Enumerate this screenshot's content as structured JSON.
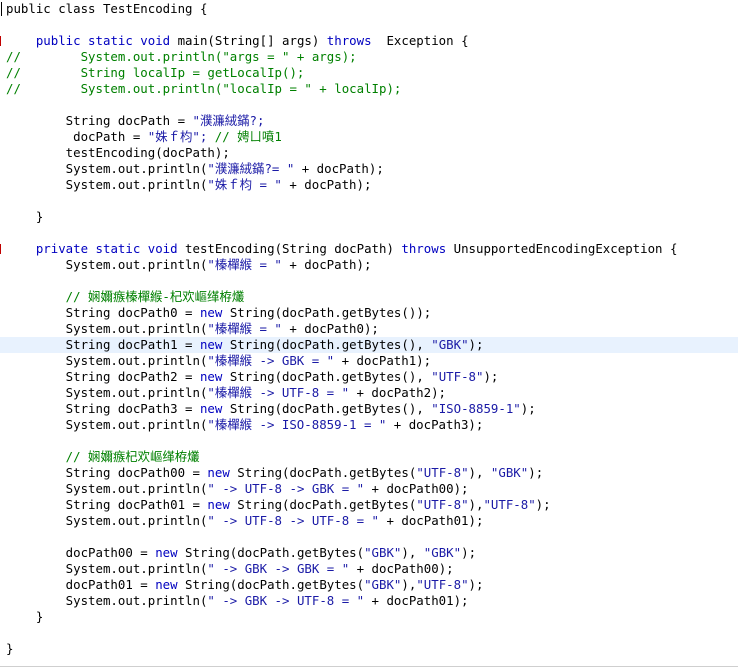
{
  "editor": {
    "lines": [
      [
        {
          "t": "public class TestEncoding {",
          "c": "plain"
        }
      ],
      [],
      [
        {
          "t": "    ",
          "c": "plain"
        },
        {
          "t": "public static void",
          "c": "kw"
        },
        {
          "t": " main(String[] args) ",
          "c": "plain"
        },
        {
          "t": "throws",
          "c": "kw"
        },
        {
          "t": "  Exception {",
          "c": "plain"
        }
      ],
      [
        {
          "t": "//        System.out.println(\"args = \" + args);",
          "c": "cm"
        }
      ],
      [
        {
          "t": "//        String localIp = getLocalIp();",
          "c": "cm"
        }
      ],
      [
        {
          "t": "//        System.out.println(\"localIp = \" + localIp);",
          "c": "cm"
        }
      ],
      [],
      [
        {
          "t": "        String docPath = ",
          "c": "plain"
        },
        {
          "t": "\"濮濂絨鏋?;",
          "c": "str"
        }
      ],
      [
        {
          "t": "         docPath = ",
          "c": "plain"
        },
        {
          "t": "\"姝ｆ枃\";",
          "c": "str"
        },
        {
          "t": " // 娉ㄩ噴1",
          "c": "cm"
        }
      ],
      [
        {
          "t": "        testEncoding(docPath);",
          "c": "plain"
        }
      ],
      [
        {
          "t": "        System.out.println(",
          "c": "plain"
        },
        {
          "t": "\"濮濂絨鏋?= \"",
          "c": "str"
        },
        {
          "t": " + docPath);",
          "c": "plain"
        }
      ],
      [
        {
          "t": "        System.out.println(",
          "c": "plain"
        },
        {
          "t": "\"姝ｆ枃 = \"",
          "c": "str"
        },
        {
          "t": " + docPath);",
          "c": "plain"
        }
      ],
      [],
      [
        {
          "t": "    }",
          "c": "plain"
        }
      ],
      [],
      [
        {
          "t": "    ",
          "c": "plain"
        },
        {
          "t": "private static void",
          "c": "kw"
        },
        {
          "t": " testEncoding(String docPath) ",
          "c": "plain"
        },
        {
          "t": "throws",
          "c": "kw"
        },
        {
          "t": " UnsupportedEncodingException {",
          "c": "plain"
        }
      ],
      [
        {
          "t": "        System.out.println(",
          "c": "plain"
        },
        {
          "t": "\"榛樿緱 = \"",
          "c": "str"
        },
        {
          "t": " + docPath);",
          "c": "plain"
        }
      ],
      [],
      [
        {
          "t": "        // 娴嬭瘯榛樿緱-杞欢嶇缂栫爜",
          "c": "cm"
        }
      ],
      [
        {
          "t": "        String docPath0 = ",
          "c": "plain"
        },
        {
          "t": "new",
          "c": "kw"
        },
        {
          "t": " String(docPath.getBytes());",
          "c": "plain"
        }
      ],
      [
        {
          "t": "        System.out.println(",
          "c": "plain"
        },
        {
          "t": "\"榛樿緱 = \"",
          "c": "str"
        },
        {
          "t": " + docPath0);",
          "c": "plain"
        }
      ],
      [
        {
          "t": "        String docPath1 = ",
          "c": "plain"
        },
        {
          "t": "new",
          "c": "kw"
        },
        {
          "t": " String(docPath.getBytes(), ",
          "c": "plain"
        },
        {
          "t": "\"GBK\"",
          "c": "str"
        },
        {
          "t": ");",
          "c": "plain"
        }
      ],
      [
        {
          "t": "        System.out.println(",
          "c": "plain"
        },
        {
          "t": "\"榛樿緱 -> GBK = \"",
          "c": "str"
        },
        {
          "t": " + docPath1);",
          "c": "plain"
        }
      ],
      [
        {
          "t": "        String docPath2 = ",
          "c": "plain"
        },
        {
          "t": "new",
          "c": "kw"
        },
        {
          "t": " String(docPath.getBytes(), ",
          "c": "plain"
        },
        {
          "t": "\"UTF-8\"",
          "c": "str"
        },
        {
          "t": ");",
          "c": "plain"
        }
      ],
      [
        {
          "t": "        System.out.println(",
          "c": "plain"
        },
        {
          "t": "\"榛樿緱 -> UTF-8 = \"",
          "c": "str"
        },
        {
          "t": " + docPath2);",
          "c": "plain"
        }
      ],
      [
        {
          "t": "        String docPath3 = ",
          "c": "plain"
        },
        {
          "t": "new",
          "c": "kw"
        },
        {
          "t": " String(docPath.getBytes(), ",
          "c": "plain"
        },
        {
          "t": "\"ISO-8859-1\"",
          "c": "str"
        },
        {
          "t": ");",
          "c": "plain"
        }
      ],
      [
        {
          "t": "        System.out.println(",
          "c": "plain"
        },
        {
          "t": "\"榛樿緱 -> ISO-8859-1 = \"",
          "c": "str"
        },
        {
          "t": " + docPath3);",
          "c": "plain"
        }
      ],
      [],
      [
        {
          "t": "        // 娴嬭瘯杞欢嶇缂栫爜",
          "c": "cm"
        }
      ],
      [
        {
          "t": "        String docPath00 = ",
          "c": "plain"
        },
        {
          "t": "new",
          "c": "kw"
        },
        {
          "t": " String(docPath.getBytes(",
          "c": "plain"
        },
        {
          "t": "\"UTF-8\"",
          "c": "str"
        },
        {
          "t": "), ",
          "c": "plain"
        },
        {
          "t": "\"GBK\"",
          "c": "str"
        },
        {
          "t": ");",
          "c": "plain"
        }
      ],
      [
        {
          "t": "        System.out.println(",
          "c": "plain"
        },
        {
          "t": "\" -> UTF-8 -> GBK = \"",
          "c": "str"
        },
        {
          "t": " + docPath00);",
          "c": "plain"
        }
      ],
      [
        {
          "t": "        String docPath01 = ",
          "c": "plain"
        },
        {
          "t": "new",
          "c": "kw"
        },
        {
          "t": " String(docPath.getBytes(",
          "c": "plain"
        },
        {
          "t": "\"UTF-8\"",
          "c": "str"
        },
        {
          "t": "),",
          "c": "plain"
        },
        {
          "t": "\"UTF-8\"",
          "c": "str"
        },
        {
          "t": ");",
          "c": "plain"
        }
      ],
      [
        {
          "t": "        System.out.println(",
          "c": "plain"
        },
        {
          "t": "\" -> UTF-8 -> UTF-8 = \"",
          "c": "str"
        },
        {
          "t": " + docPath01);",
          "c": "plain"
        }
      ],
      [],
      [
        {
          "t": "        docPath00 = ",
          "c": "plain"
        },
        {
          "t": "new",
          "c": "kw"
        },
        {
          "t": " String(docPath.getBytes(",
          "c": "plain"
        },
        {
          "t": "\"GBK\"",
          "c": "str"
        },
        {
          "t": "), ",
          "c": "plain"
        },
        {
          "t": "\"GBK\"",
          "c": "str"
        },
        {
          "t": ");",
          "c": "plain"
        }
      ],
      [
        {
          "t": "        System.out.println(",
          "c": "plain"
        },
        {
          "t": "\" -> GBK -> GBK = \"",
          "c": "str"
        },
        {
          "t": " + docPath00);",
          "c": "plain"
        }
      ],
      [
        {
          "t": "        docPath01 = ",
          "c": "plain"
        },
        {
          "t": "new",
          "c": "kw"
        },
        {
          "t": " String(docPath.getBytes(",
          "c": "plain"
        },
        {
          "t": "\"GBK\"",
          "c": "str"
        },
        {
          "t": "),",
          "c": "plain"
        },
        {
          "t": "\"UTF-8\"",
          "c": "str"
        },
        {
          "t": ");",
          "c": "plain"
        }
      ],
      [
        {
          "t": "        System.out.println(",
          "c": "plain"
        },
        {
          "t": "\" -> GBK -> UTF-8 = \"",
          "c": "str"
        },
        {
          "t": " + docPath01);",
          "c": "plain"
        }
      ],
      [
        {
          "t": "    }",
          "c": "plain"
        }
      ],
      [],
      [
        {
          "t": "}",
          "c": "plain"
        }
      ]
    ],
    "highlighted_line_index": 21,
    "fold_marker_lines": [
      2,
      15
    ],
    "colors": {
      "keyword": "#0000c0",
      "string": "#1a1aa6",
      "comment": "#008000",
      "text": "#000000",
      "highlight": "#e8f2fe"
    }
  }
}
